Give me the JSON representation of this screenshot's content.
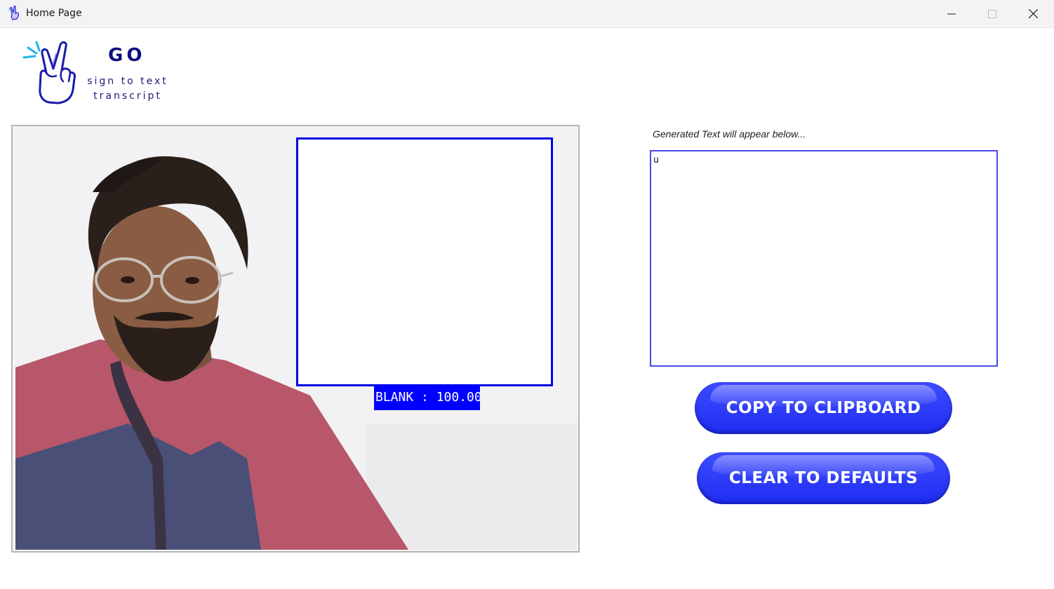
{
  "window": {
    "title": "Home Page",
    "controls": [
      "minimize-icon",
      "maximize-icon",
      "close-icon"
    ]
  },
  "logo": {
    "title": "GO",
    "subtitle_line1": "sign to text",
    "subtitle_line2": "transcript",
    "icon": "peace-hand-icon"
  },
  "camera": {
    "roi_label": "BLANK : 100.00"
  },
  "output": {
    "label": "Generated Text will appear below...",
    "text": "u"
  },
  "buttons": {
    "copy": "COPY TO CLIPBOARD",
    "clear": "CLEAR TO DEFAULTS"
  },
  "colors": {
    "accent": "#1f2df2",
    "roi_border": "#0000e6",
    "logo_text": "#0d0d82"
  }
}
